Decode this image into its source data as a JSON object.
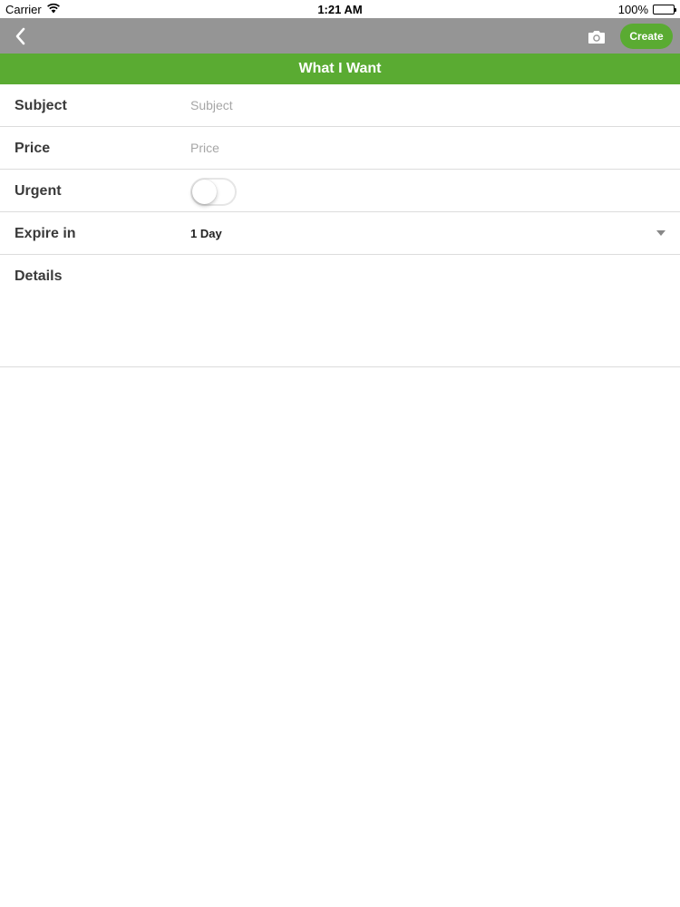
{
  "status_bar": {
    "carrier": "Carrier",
    "time": "1:21 AM",
    "battery": "100%",
    "battery_level": 1.0
  },
  "nav": {
    "back_icon": "chevron-left-icon",
    "camera_icon": "camera-icon",
    "create_label": "Create"
  },
  "page": {
    "title": "What I Want"
  },
  "form": {
    "subject": {
      "label": "Subject",
      "placeholder": "Subject",
      "value": ""
    },
    "price": {
      "label": "Price",
      "placeholder": "Price",
      "value": ""
    },
    "urgent": {
      "label": "Urgent",
      "on": false
    },
    "expire": {
      "label": "Expire in",
      "selected": "1 Day"
    },
    "details": {
      "label": "Details",
      "value": ""
    }
  },
  "colors": {
    "accent_green": "#5aab32",
    "nav_gray": "#959595",
    "divider": "#dcdcdc"
  }
}
